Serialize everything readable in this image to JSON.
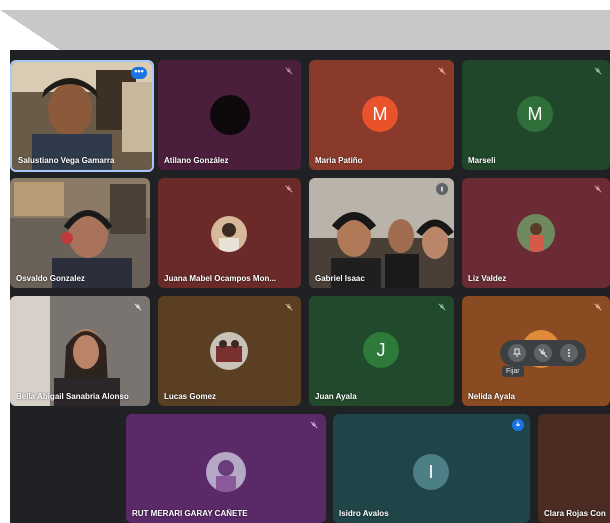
{
  "tiles": [
    {
      "name": "Salustiano Vega Gamarra",
      "type": "video",
      "bg": "#4a4237"
    },
    {
      "name": "Atilano González",
      "type": "photo-avatar",
      "bg": "#4b1e3b",
      "muted": true
    },
    {
      "name": "Maria Patiño",
      "type": "letter",
      "bg": "#8a3a2b",
      "letter": "M",
      "avatar_color": "#e8532b",
      "muted": true
    },
    {
      "name": "Marseli",
      "type": "letter",
      "bg": "#21472a",
      "letter": "M",
      "avatar_color": "#2e6f3a",
      "muted": true
    },
    {
      "name": "Osvaldo Gonzalez",
      "type": "video",
      "bg": "#56514a"
    },
    {
      "name": "Juana Mabel Ocampos Mon...",
      "type": "photo-avatar",
      "bg": "#6a2a2a",
      "muted": true
    },
    {
      "name": "Gabriel Isaac",
      "type": "video",
      "bg": "#6b6a66"
    },
    {
      "name": "Liz Valdez",
      "type": "photo-avatar",
      "bg": "#6a2b34",
      "muted": true
    },
    {
      "name": "Bella Abigail Sanabria Alonso",
      "type": "video",
      "bg": "#4b4a4c",
      "muted": true
    },
    {
      "name": "Lucas Gomez",
      "type": "photo-avatar",
      "bg": "#5a3f22",
      "muted": true
    },
    {
      "name": "Juan Ayala",
      "type": "letter",
      "bg": "#21492b",
      "letter": "J",
      "avatar_color": "#2e7a3a",
      "muted": true
    },
    {
      "name": "Nelida Ayala",
      "type": "photo-avatar",
      "bg": "#8a4b22",
      "muted": true
    },
    {
      "name": "RUT MERARI GARAY CAÑETE",
      "type": "photo-avatar",
      "bg": "#5a2a68",
      "muted": true
    },
    {
      "name": "Isidro Avalos",
      "type": "letter",
      "bg": "#1f4548",
      "letter": "I",
      "avatar_color": "#4d7f86",
      "muted": true
    },
    {
      "name": "Clara Rojas Con",
      "type": "photo-avatar",
      "bg": "#4a2c22"
    }
  ],
  "pin_tooltip": "Fijar",
  "icons": {
    "mic_off": "mic-off-icon",
    "more": "more-options-icon",
    "pin": "pin-icon"
  }
}
